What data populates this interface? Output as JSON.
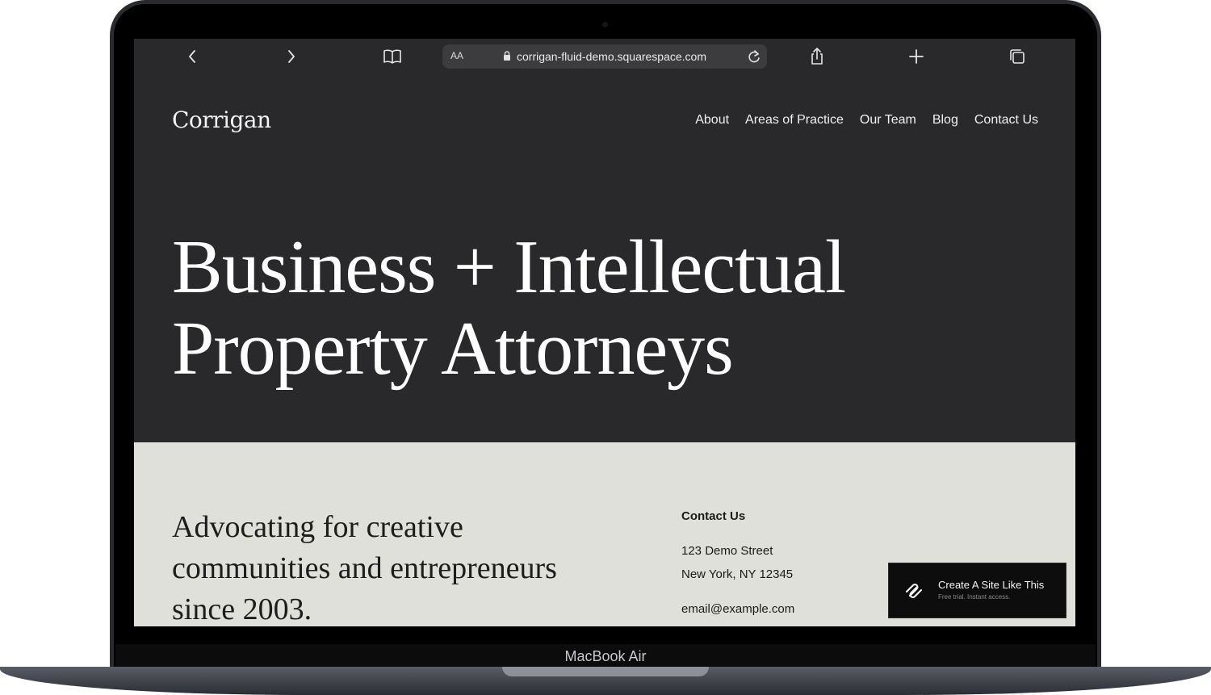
{
  "device": {
    "label": "MacBook Air"
  },
  "browser": {
    "text_size_label": "AA",
    "url": "corrigan-fluid-demo.squarespace.com"
  },
  "site": {
    "logo": "Corrigan",
    "nav": [
      "About",
      "Areas of Practice",
      "Our Team",
      "Blog",
      "Contact Us"
    ],
    "hero": {
      "line1": "Business + Intellectual",
      "line2": "Property Attorneys"
    },
    "tagline": {
      "line1": "Advocating for creative",
      "line2": "communities and entrepreneurs",
      "line3": "since 2003."
    },
    "contact": {
      "heading": "Contact Us",
      "street": "123 Demo Street",
      "city": "New York, NY 12345",
      "email": "email@example.com"
    }
  },
  "badge": {
    "title": "Create A Site Like This",
    "subtitle": "Free trial. Instant access."
  },
  "colors": {
    "dark_bg": "#29282a",
    "light_bg": "#dfe0da",
    "text_light": "#ffffff",
    "text_dark": "#1d1d1d"
  }
}
